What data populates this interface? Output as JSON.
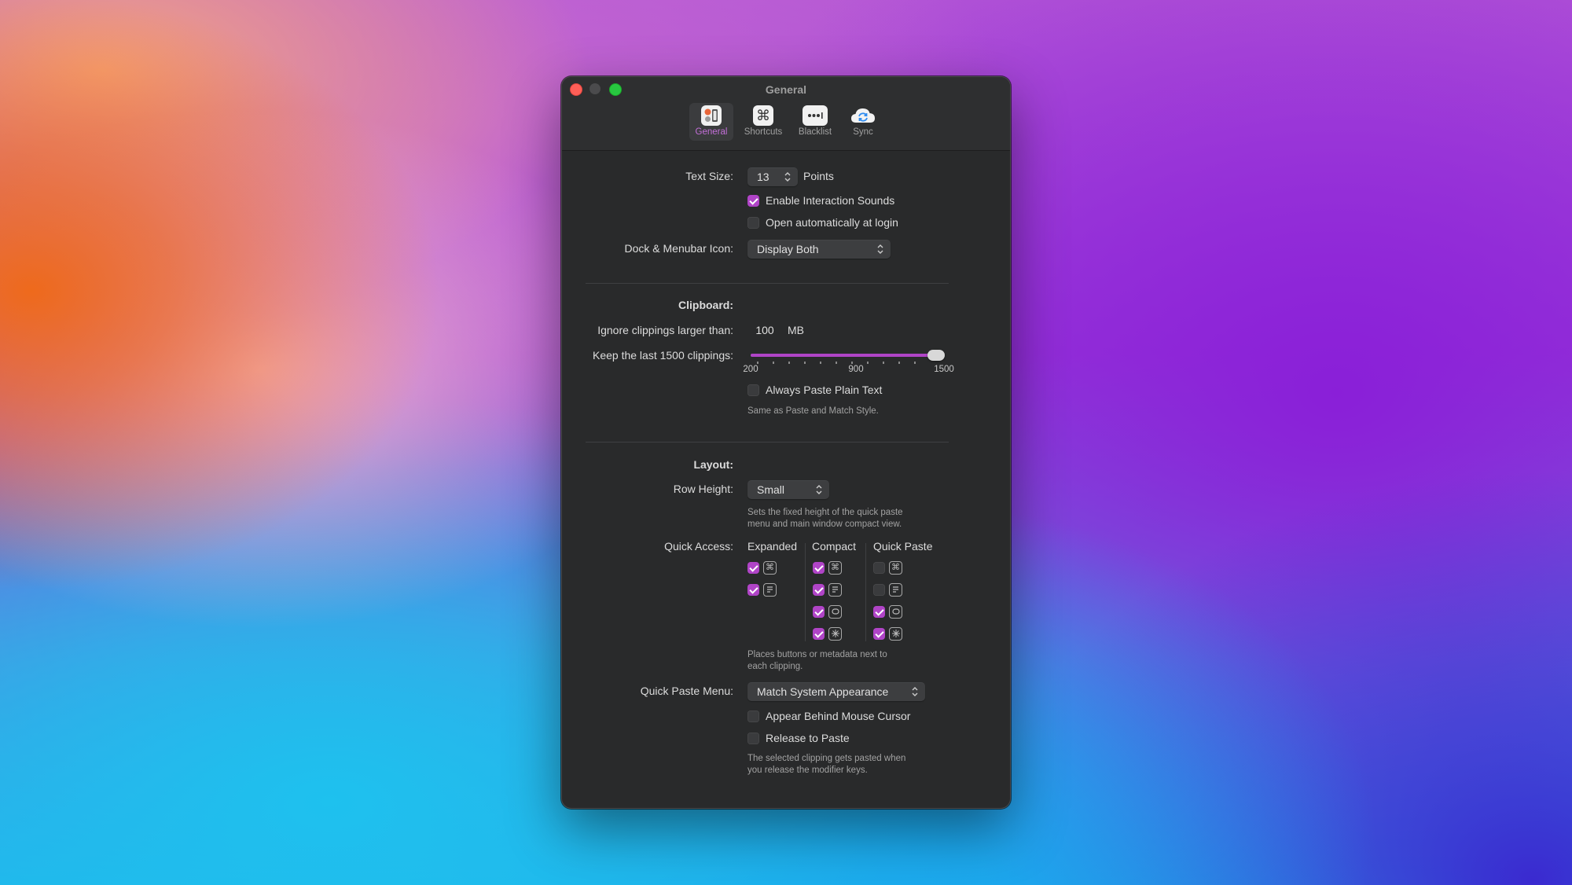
{
  "window": {
    "title": "General"
  },
  "toolbar": {
    "items": [
      {
        "label": "General",
        "icon": "general-icon",
        "selected": true
      },
      {
        "label": "Shortcuts",
        "icon": "command-icon",
        "selected": false
      },
      {
        "label": "Blacklist",
        "icon": "blacklist-icon",
        "selected": false
      },
      {
        "label": "Sync",
        "icon": "sync-cloud-icon",
        "selected": false
      }
    ]
  },
  "general": {
    "text_size_label": "Text Size:",
    "text_size_value": "13",
    "text_size_unit": "Points",
    "enable_sounds_label": "Enable Interaction Sounds",
    "enable_sounds_checked": true,
    "open_login_label": "Open automatically at login",
    "open_login_checked": false,
    "dock_icon_label": "Dock & Menubar Icon:",
    "dock_icon_value": "Display Both"
  },
  "clipboard": {
    "section_label": "Clipboard:",
    "ignore_label": "Ignore clippings larger than:",
    "ignore_value": "100",
    "ignore_unit": "MB",
    "keep_label": "Keep the last 1500 clippings:",
    "slider": {
      "min": 200,
      "max": 1500,
      "value": 1500,
      "min_label": "200",
      "mid_label": "900",
      "max_label": "1500"
    },
    "plain_text_label": "Always Paste Plain Text",
    "plain_text_checked": false,
    "plain_text_note": "Same as Paste and Match Style."
  },
  "layout": {
    "section_label": "Layout:",
    "row_height_label": "Row Height:",
    "row_height_value": "Small",
    "row_height_note_1": "Sets the fixed height of the quick paste",
    "row_height_note_2": "menu and main window compact view.",
    "quick_access_label": "Quick Access:",
    "columns": [
      "Expanded",
      "Compact",
      "Quick Paste"
    ],
    "expanded": [
      true,
      true
    ],
    "compact": [
      true,
      true,
      true,
      true
    ],
    "quick_paste": [
      false,
      false,
      true,
      true
    ],
    "quick_access_note_1": "Places buttons or metadata next to",
    "quick_access_note_2": "each clipping.",
    "quick_paste_menu_label": "Quick Paste Menu:",
    "quick_paste_menu_value": "Match System Appearance",
    "behind_cursor_label": "Appear Behind Mouse Cursor",
    "behind_cursor_checked": false,
    "release_label": "Release to Paste",
    "release_checked": false,
    "release_note_1": "The selected clipping gets pasted when",
    "release_note_2": "you release the modifier keys."
  },
  "colors": {
    "accent": "#b044c7",
    "window_bg": "#292a2b"
  }
}
